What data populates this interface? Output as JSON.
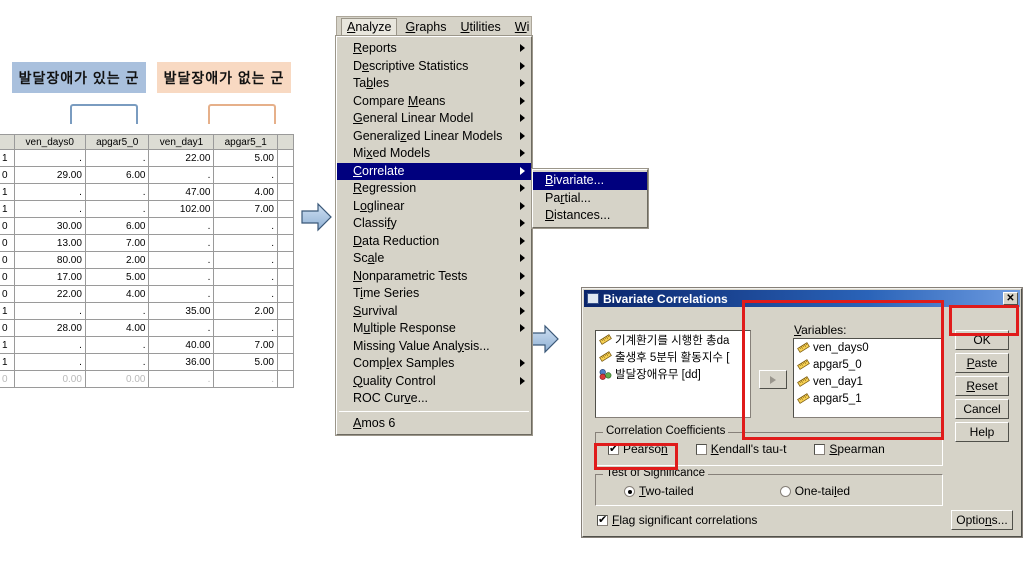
{
  "sheet": {
    "group_headers": [
      {
        "label": "발달장애가 있는 군",
        "color": "#a9c0dd"
      },
      {
        "label": "발달장애가 없는 군",
        "color": "#f8d9c2"
      }
    ],
    "columns": [
      "",
      "ven_days0",
      "apgar5_0",
      "ven_day1",
      "apgar5_1",
      ""
    ],
    "rows": [
      [
        "1",
        ".",
        ".",
        "22.00",
        "5.00"
      ],
      [
        "0",
        "29.00",
        "6.00",
        ".",
        "."
      ],
      [
        "1",
        ".",
        ".",
        "47.00",
        "4.00"
      ],
      [
        "1",
        ".",
        ".",
        "102.00",
        "7.00"
      ],
      [
        "0",
        "30.00",
        "6.00",
        ".",
        "."
      ],
      [
        "0",
        "13.00",
        "7.00",
        ".",
        "."
      ],
      [
        "0",
        "80.00",
        "2.00",
        ".",
        "."
      ],
      [
        "0",
        "17.00",
        "5.00",
        ".",
        "."
      ],
      [
        "0",
        "22.00",
        "4.00",
        ".",
        "."
      ],
      [
        "1",
        ".",
        ".",
        "35.00",
        "2.00"
      ],
      [
        "0",
        "28.00",
        "4.00",
        ".",
        "."
      ],
      [
        "1",
        ".",
        ".",
        "40.00",
        "7.00"
      ],
      [
        "1",
        ".",
        ".",
        "36.00",
        "5.00"
      ],
      [
        "0",
        "0.00",
        "0.00",
        ".",
        "."
      ]
    ]
  },
  "menu": {
    "bar": [
      {
        "label": "Analyze",
        "mnemonic": "A",
        "selected": true
      },
      {
        "label": "Graphs",
        "mnemonic": "G",
        "selected": false
      },
      {
        "label": "Utilities",
        "mnemonic": "U",
        "selected": false
      },
      {
        "label": "Wi",
        "mnemonic": "W",
        "selected": false
      }
    ],
    "items": [
      {
        "label": "Reports",
        "mnemonic": "R",
        "submenu": true,
        "highlighted": false
      },
      {
        "label": "Descriptive Statistics",
        "mnemonic": "e",
        "submenu": true,
        "highlighted": false
      },
      {
        "label": "Tables",
        "mnemonic": "b",
        "submenu": true,
        "highlighted": false
      },
      {
        "label": "Compare Means",
        "mnemonic": "M",
        "submenu": true,
        "highlighted": false
      },
      {
        "label": "General Linear Model",
        "mnemonic": "G",
        "submenu": true,
        "highlighted": false
      },
      {
        "label": "Generalized Linear Models",
        "mnemonic": "z",
        "submenu": true,
        "highlighted": false
      },
      {
        "label": "Mixed Models",
        "mnemonic": "x",
        "submenu": true,
        "highlighted": false
      },
      {
        "label": "Correlate",
        "mnemonic": "C",
        "submenu": true,
        "highlighted": true
      },
      {
        "label": "Regression",
        "mnemonic": "R",
        "submenu": true,
        "highlighted": false
      },
      {
        "label": "Loglinear",
        "mnemonic": "o",
        "submenu": true,
        "highlighted": false
      },
      {
        "label": "Classify",
        "mnemonic": "f",
        "submenu": true,
        "highlighted": false
      },
      {
        "label": "Data Reduction",
        "mnemonic": "D",
        "submenu": true,
        "highlighted": false
      },
      {
        "label": "Scale",
        "mnemonic": "a",
        "submenu": true,
        "highlighted": false
      },
      {
        "label": "Nonparametric Tests",
        "mnemonic": "N",
        "submenu": true,
        "highlighted": false
      },
      {
        "label": "Time Series",
        "mnemonic": "i",
        "submenu": true,
        "highlighted": false
      },
      {
        "label": "Survival",
        "mnemonic": "S",
        "submenu": true,
        "highlighted": false
      },
      {
        "label": "Multiple Response",
        "mnemonic": "u",
        "submenu": true,
        "highlighted": false
      },
      {
        "label": "Missing Value Analysis...",
        "mnemonic": "y",
        "submenu": false,
        "highlighted": false
      },
      {
        "label": "Complex Samples",
        "mnemonic": "l",
        "submenu": true,
        "highlighted": false
      },
      {
        "label": "Quality Control",
        "mnemonic": "Q",
        "submenu": true,
        "highlighted": false
      },
      {
        "label": "ROC Curve...",
        "mnemonic": "v",
        "submenu": false,
        "highlighted": false
      },
      {
        "separator": true
      },
      {
        "label": "Amos 6",
        "mnemonic": "A",
        "submenu": false,
        "highlighted": false
      }
    ],
    "submenu": [
      {
        "label": "Bivariate...",
        "mnemonic": "B",
        "highlighted": true
      },
      {
        "label": "Partial...",
        "mnemonic": "r",
        "highlighted": false
      },
      {
        "label": "Distances...",
        "mnemonic": "D",
        "highlighted": false
      }
    ]
  },
  "dialog": {
    "title": "Bivariate Correlations",
    "close_label": "✕",
    "source_variables": [
      {
        "label": "기계환기를 시행한 총da",
        "icon": "ruler-icon"
      },
      {
        "label": "출생후 5분뒤 활동지수 [",
        "icon": "ruler-icon"
      },
      {
        "label": "발달장애유무 [dd]",
        "icon": "nominal-icon"
      }
    ],
    "variables_label": "Variables:",
    "variables": [
      {
        "label": "ven_days0",
        "icon": "ruler-icon"
      },
      {
        "label": "apgar5_0",
        "icon": "ruler-icon"
      },
      {
        "label": "ven_day1",
        "icon": "ruler-icon"
      },
      {
        "label": "apgar5_1",
        "icon": "ruler-icon"
      }
    ],
    "buttons": [
      {
        "id": "ok",
        "label": "OK"
      },
      {
        "id": "paste",
        "label": "Paste"
      },
      {
        "id": "reset",
        "label": "Reset"
      },
      {
        "id": "cancel",
        "label": "Cancel"
      },
      {
        "id": "help",
        "label": "Help"
      }
    ],
    "options_label": "Options...",
    "correlation_coefficients": {
      "title": "Correlation Coefficients",
      "items": [
        {
          "label": "Pearson",
          "checked": true
        },
        {
          "label": "Kendall's tau-t",
          "checked": false
        },
        {
          "label": "Spearman",
          "checked": false
        }
      ]
    },
    "test_of_significance": {
      "title": "Test of Significance",
      "items": [
        {
          "label": "Two-tailed",
          "selected": true
        },
        {
          "label": "One-tailed",
          "selected": false
        }
      ]
    },
    "flag_significant": {
      "label": "Flag significant correlations",
      "checked": true
    }
  },
  "annotations": {
    "highlight_color": "#e01b1b",
    "arrow_color": "#8fb0d4"
  }
}
